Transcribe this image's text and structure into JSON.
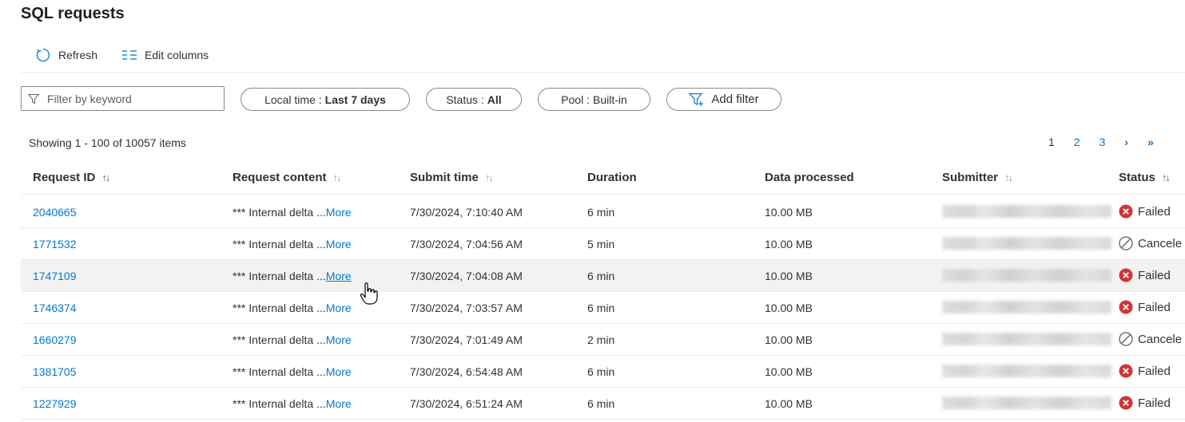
{
  "page": {
    "title": "SQL requests"
  },
  "toolbar": {
    "refresh_label": "Refresh",
    "edit_columns_label": "Edit columns"
  },
  "filters": {
    "search_placeholder": "Filter by keyword",
    "time": {
      "label": "Local time :",
      "value": "Last 7 days"
    },
    "status": {
      "label": "Status :",
      "value": "All"
    },
    "pool": {
      "label": "Pool :",
      "value": "Built-in"
    },
    "add_filter_label": "Add filter"
  },
  "summary": {
    "showing_text": "Showing 1 - 100 of 10057 items"
  },
  "pagination": {
    "pages": [
      "1",
      "2",
      "3"
    ],
    "current": "1",
    "next_icon": "›",
    "last_icon": "»"
  },
  "table": {
    "columns": [
      "Request ID",
      "Request content",
      "Submit time",
      "Duration",
      "Data processed",
      "Submitter",
      "Status"
    ],
    "more_label": "More",
    "rows": [
      {
        "id": "2040665",
        "content": "*** Internal delta ...",
        "submit_time": "7/30/2024, 7:10:40 AM",
        "duration": "6 min",
        "data": "10.00 MB",
        "status": "Failed"
      },
      {
        "id": "1771532",
        "content": "*** Internal delta ...",
        "submit_time": "7/30/2024, 7:04:56 AM",
        "duration": "5 min",
        "data": "10.00 MB",
        "status": "Cancele"
      },
      {
        "id": "1747109",
        "content": "*** Internal delta ...",
        "submit_time": "7/30/2024, 7:04:08 AM",
        "duration": "6 min",
        "data": "10.00 MB",
        "status": "Failed"
      },
      {
        "id": "1746374",
        "content": "*** Internal delta ...",
        "submit_time": "7/30/2024, 7:03:57 AM",
        "duration": "6 min",
        "data": "10.00 MB",
        "status": "Failed"
      },
      {
        "id": "1660279",
        "content": "*** Internal delta ...",
        "submit_time": "7/30/2024, 7:01:49 AM",
        "duration": "2 min",
        "data": "10.00 MB",
        "status": "Cancele"
      },
      {
        "id": "1381705",
        "content": "*** Internal delta ...",
        "submit_time": "7/30/2024, 6:54:48 AM",
        "duration": "6 min",
        "data": "10.00 MB",
        "status": "Failed"
      },
      {
        "id": "1227929",
        "content": "*** Internal delta ...",
        "submit_time": "7/30/2024, 6:51:24 AM",
        "duration": "6 min",
        "data": "10.00 MB",
        "status": "Failed"
      }
    ]
  },
  "colors": {
    "accent": "#0078d4",
    "failed": "#d13438",
    "text": "#323130",
    "border": "#edebe9"
  }
}
